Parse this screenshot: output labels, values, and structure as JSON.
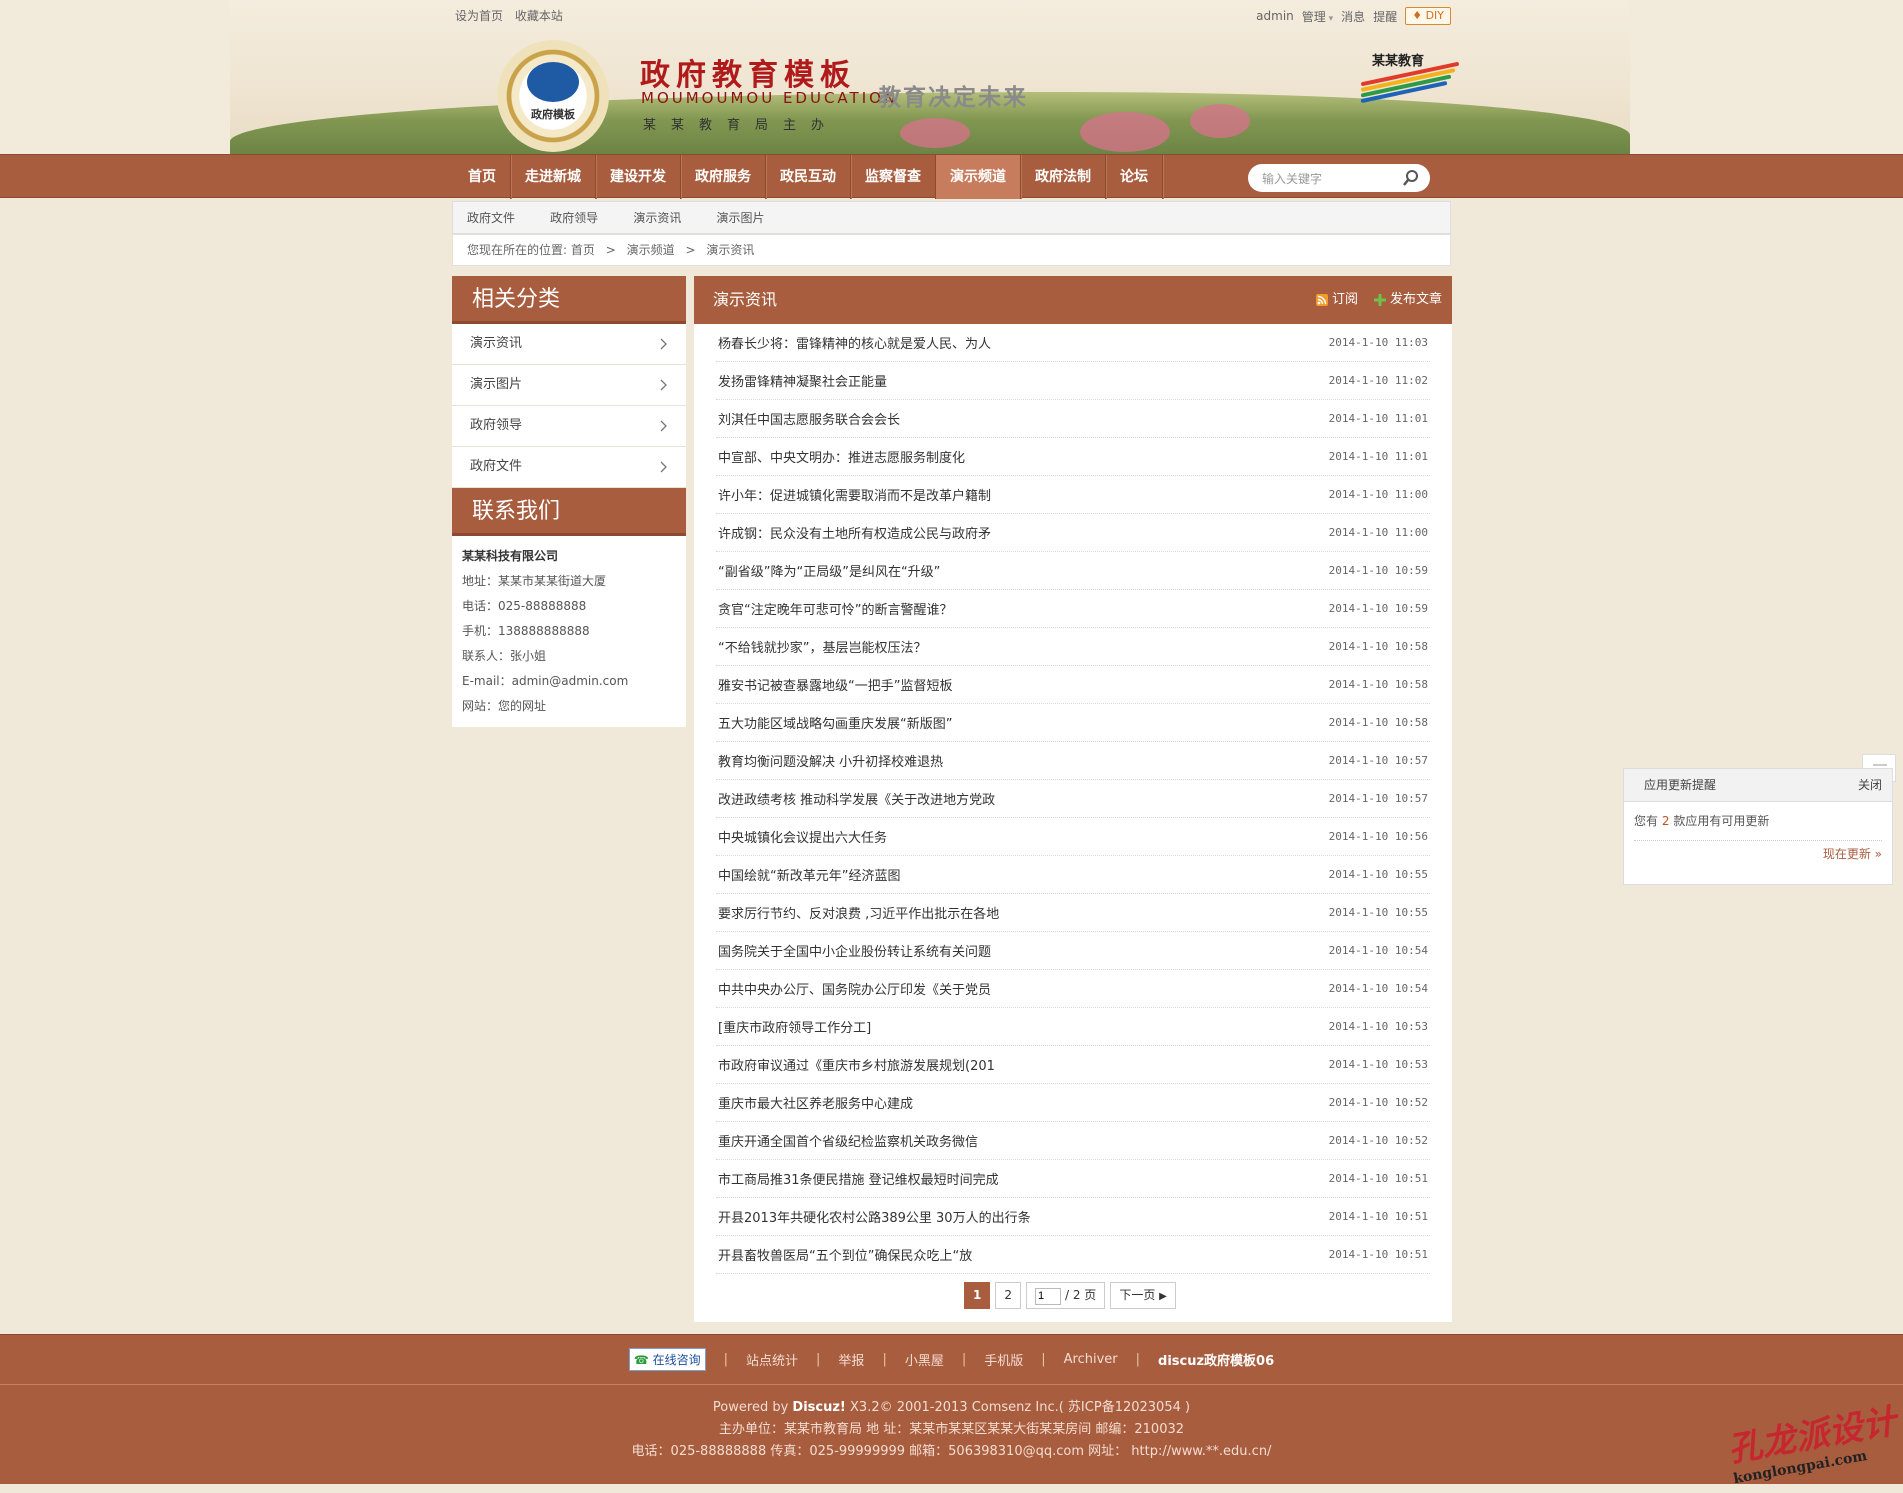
{
  "topbar": {
    "left_links": [
      "设为首页",
      "收藏本站"
    ],
    "user": "admin",
    "manage": "管理",
    "messages": "消息",
    "remind": "提醒",
    "diy": "DIY"
  },
  "banner": {
    "emblem_label": "政府模板",
    "title": "政府教育模板",
    "title_en": "MOUMOUMOU EDUCATION",
    "org": "某某教育局主办",
    "slogan": "教育决定未来",
    "brand": "某某教育"
  },
  "nav": {
    "items": [
      "首页",
      "走进新城",
      "建设开发",
      "政府服务",
      "政民互动",
      "监察督查",
      "演示频道",
      "政府法制",
      "论坛"
    ],
    "active": "演示频道",
    "search_placeholder": "输入关键字"
  },
  "subnav": {
    "items": [
      "政府文件",
      "政府领导",
      "演示资讯",
      "演示图片"
    ]
  },
  "breadcrumb": {
    "prefix": "您现在所在的位置:",
    "items": [
      "首页",
      "演示频道",
      "演示资讯"
    ],
    "separator": ">"
  },
  "sidebar": {
    "category_title": "相关分类",
    "categories": [
      "演示资讯",
      "演示图片",
      "政府领导",
      "政府文件"
    ],
    "contact_title": "联系我们",
    "contact": {
      "company": "某某科技有限公司",
      "address": "地址：某某市某某街道大厦",
      "phone": "电话：025-88888888",
      "mobile": "手机：138888888888",
      "person": "联系人：张小姐",
      "email": "E-mail：admin@admin.com",
      "website": "网站：您的网址"
    }
  },
  "main": {
    "title": "演示资讯",
    "subscribe": "订阅",
    "publish": "发布文章",
    "articles": [
      {
        "title": "杨春长少将：雷锋精神的核心就是爱人民、为人",
        "date": "2014-1-10 11:03"
      },
      {
        "title": "发扬雷锋精神凝聚社会正能量",
        "date": "2014-1-10 11:02"
      },
      {
        "title": "刘淇任中国志愿服务联合会会长",
        "date": "2014-1-10 11:01"
      },
      {
        "title": "中宣部、中央文明办：推进志愿服务制度化",
        "date": "2014-1-10 11:01"
      },
      {
        "title": "许小年：促进城镇化需要取消而不是改革户籍制",
        "date": "2014-1-10 11:00"
      },
      {
        "title": "许成钢：民众没有土地所有权造成公民与政府矛",
        "date": "2014-1-10 11:00"
      },
      {
        "title": "“副省级”降为“正局级”是纠风在“升级”",
        "date": "2014-1-10 10:59"
      },
      {
        "title": "贪官“注定晚年可悲可怜”的断言警醒谁？",
        "date": "2014-1-10 10:59"
      },
      {
        "title": "“不给钱就抄家”，基层岂能权压法？",
        "date": "2014-1-10 10:58"
      },
      {
        "title": "雅安书记被查暴露地级“一把手”监督短板",
        "date": "2014-1-10 10:58"
      },
      {
        "title": "五大功能区域战略勾画重庆发展“新版图”",
        "date": "2014-1-10 10:58"
      },
      {
        "title": "教育均衡问题没解决 小升初择校难退热",
        "date": "2014-1-10 10:57"
      },
      {
        "title": "改进政绩考核 推动科学发展《关于改进地方党政",
        "date": "2014-1-10 10:57"
      },
      {
        "title": "中央城镇化会议提出六大任务",
        "date": "2014-1-10 10:56"
      },
      {
        "title": "中国绘就“新改革元年”经济蓝图",
        "date": "2014-1-10 10:55"
      },
      {
        "title": "要求厉行节约、反对浪费 ,习近平作出批示在各地",
        "date": "2014-1-10 10:55"
      },
      {
        "title": "国务院关于全国中小企业股份转让系统有关问题",
        "date": "2014-1-10 10:54"
      },
      {
        "title": "中共中央办公厅、国务院办公厅印发《关于党员",
        "date": "2014-1-10 10:54"
      },
      {
        "title": "[重庆市政府领导工作分工]",
        "date": "2014-1-10 10:53"
      },
      {
        "title": "市政府审议通过《重庆市乡村旅游发展规划(201",
        "date": "2014-1-10 10:53"
      },
      {
        "title": "重庆市最大社区养老服务中心建成",
        "date": "2014-1-10 10:52"
      },
      {
        "title": "重庆开通全国首个省级纪检监察机关政务微信",
        "date": "2014-1-10 10:52"
      },
      {
        "title": "市工商局推31条便民措施 登记维权最短时间完成",
        "date": "2014-1-10 10:51"
      },
      {
        "title": "开县2013年共硬化农村公路389公里 30万人的出行条",
        "date": "2014-1-10 10:51"
      },
      {
        "title": "开县畜牧兽医局“五个到位”确保民众吃上“放",
        "date": "2014-1-10 10:51"
      }
    ],
    "pager": {
      "current": "1",
      "page2": "2",
      "input_value": "1",
      "total": "/ 2 页",
      "next": "下一页"
    }
  },
  "popup": {
    "title": "应用更新提醒",
    "close": "关闭",
    "text_before": "您有",
    "count": "2",
    "text_after": "款应用有可用更新",
    "update_link": "现在更新 »"
  },
  "footer": {
    "consult": "在线咨询",
    "links": [
      "站点统计",
      "举报",
      "小黑屋",
      "手机版",
      "Archiver"
    ],
    "brand": "discuz政府模板06",
    "powered_label": "Powered by",
    "powered_name": "Discuz!",
    "powered_rest": "X3.2© 2001-2013 Comsenz Inc.( 苏ICP备12023054 )",
    "line2": "主办单位：某某市教育局 地 址：某某市某某区某某大街某某房间 邮编：210032",
    "line3": "电话：025-88888888 传真：025-99999999 邮箱：506398310@qq.com 网址： http://www.**.edu.cn/"
  },
  "watermark": {
    "main": "孔龙派设计",
    "sub": "konglongpai.com"
  },
  "colors": {
    "brand": "#a85d3f",
    "background": "#f0e8d8",
    "accent": "#c2541f"
  }
}
